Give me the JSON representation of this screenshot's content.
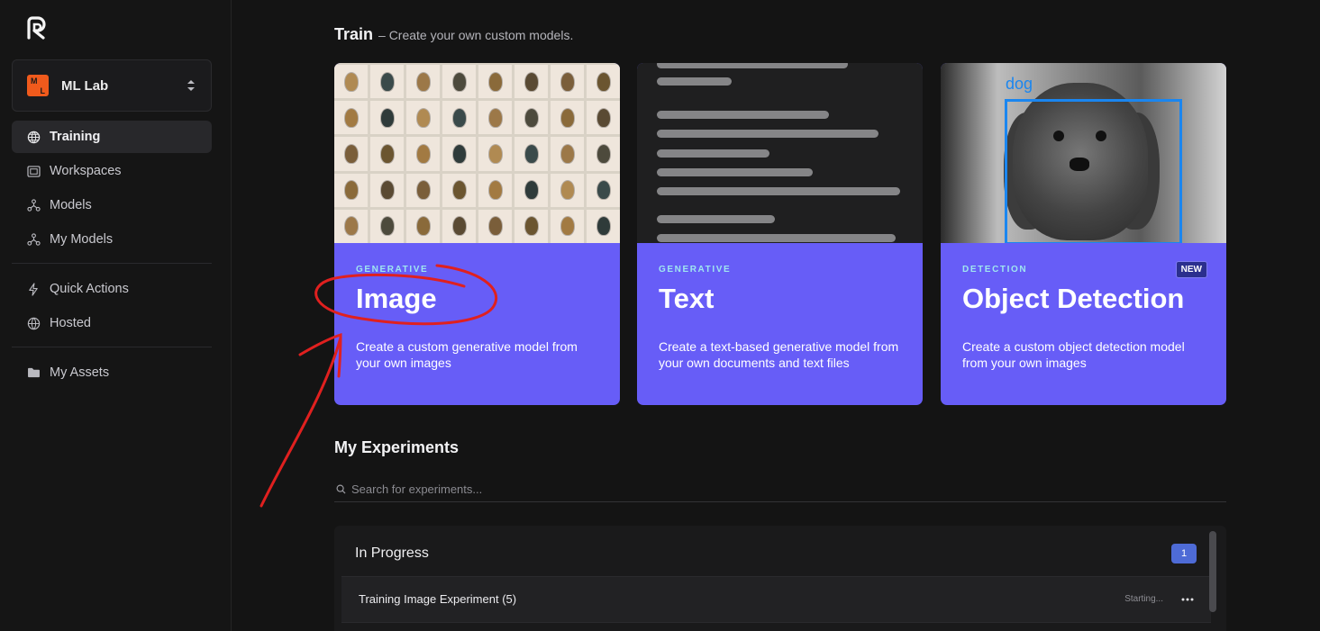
{
  "sidebar": {
    "workspace": {
      "badge_top": "M",
      "badge_bottom": "L",
      "name": "ML Lab"
    },
    "nav_primary": [
      {
        "label": "Training",
        "icon": "globe-grid-icon"
      },
      {
        "label": "Workspaces",
        "icon": "workspace-icon"
      },
      {
        "label": "Models",
        "icon": "models-icon"
      },
      {
        "label": "My Models",
        "icon": "my-models-icon"
      }
    ],
    "nav_secondary": [
      {
        "label": "Quick Actions",
        "icon": "lightning-icon"
      },
      {
        "label": "Hosted",
        "icon": "globe-icon"
      }
    ],
    "nav_tertiary": [
      {
        "label": "My Assets",
        "icon": "folder-icon"
      }
    ]
  },
  "train": {
    "title": "Train",
    "subtitle": "– Create your own custom models."
  },
  "cards": [
    {
      "kicker": "GENERATIVE",
      "title": "Image",
      "description": "Create a custom generative model from your own images"
    },
    {
      "kicker": "GENERATIVE",
      "title": "Text",
      "description": "Create a text-based generative model from your own documents and text files"
    },
    {
      "kicker": "DETECTION",
      "title": "Object Detection",
      "description": "Create a custom object detection model from your own images",
      "badge": "NEW",
      "detection_label": "dog"
    }
  ],
  "experiments": {
    "title": "My Experiments",
    "search_placeholder": "Search for experiments...",
    "section": "In Progress",
    "count": "1",
    "rows": [
      {
        "name": "Training Image Experiment (5)",
        "status": "Starting..."
      }
    ]
  },
  "colors": {
    "accent": "#675df7",
    "annotation": "#e0201f",
    "detection_box": "#1a86f0"
  }
}
